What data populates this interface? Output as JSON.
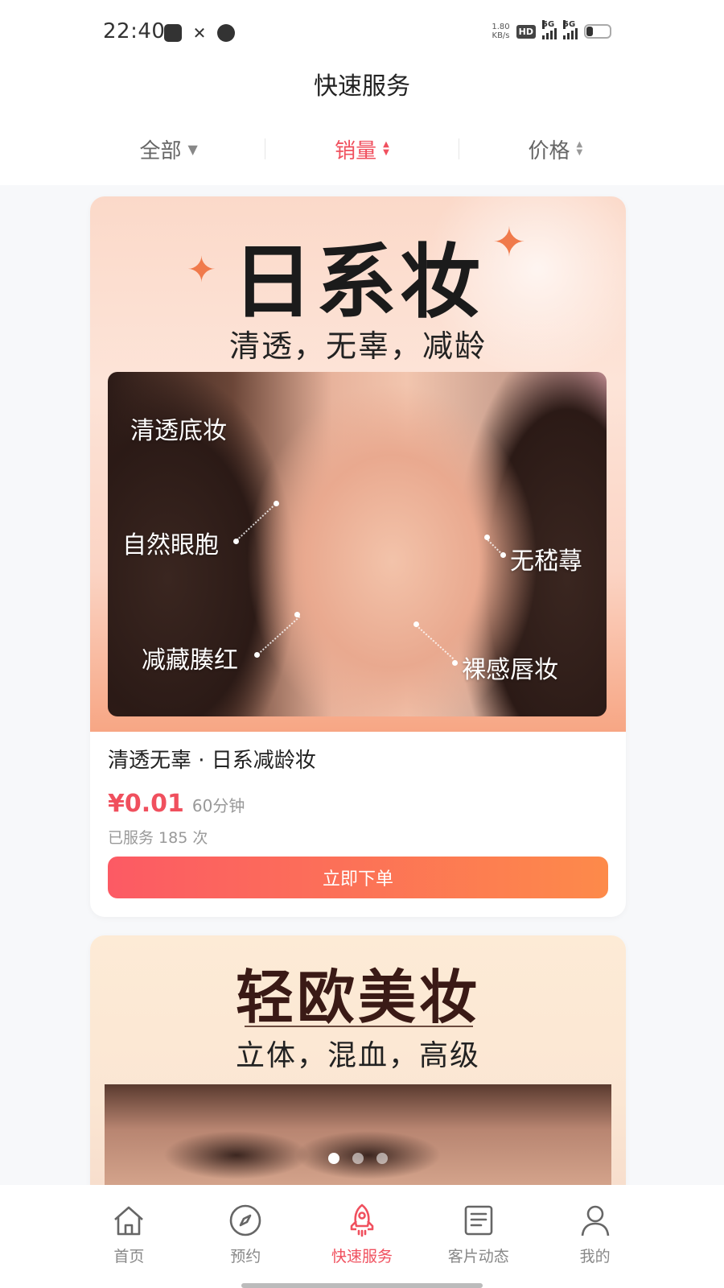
{
  "status_bar": {
    "time": "22:40",
    "net_speed_value": "1.80",
    "net_speed_unit": "KB/s",
    "hd_label": "HD",
    "signal1_label": "5G",
    "signal2_label": "5G"
  },
  "header": {
    "title": "快速服务",
    "filters": [
      {
        "label": "全部",
        "icon": "caret-down-icon"
      },
      {
        "label": "销量",
        "icon": "sort-icon",
        "active": true
      },
      {
        "label": "价格",
        "icon": "sort-icon"
      }
    ]
  },
  "services": [
    {
      "banner_title": "日系妆",
      "banner_subtitle": "清透，无辜，减龄",
      "photo_labels": [
        "清透底妆",
        "自然眼胞",
        "无嵇蕁",
        "减藏腠红",
        "裸感唇妆"
      ],
      "name": "清透无辜 · 日系减龄妆",
      "price": "¥0.01",
      "duration": "60分钟",
      "served": "已服务 185 次",
      "order_button": "立即下单"
    },
    {
      "banner_title": "轻欧美妆",
      "banner_subtitle": "立体，混血，高级"
    }
  ],
  "carousel": {
    "count": 3,
    "active_index": 0
  },
  "tab_bar": {
    "items": [
      {
        "label": "首页",
        "icon": "home-icon"
      },
      {
        "label": "预约",
        "icon": "compass-icon"
      },
      {
        "label": "快速服务",
        "icon": "rocket-icon",
        "active": true
      },
      {
        "label": "客片动态",
        "icon": "news-icon"
      },
      {
        "label": "我的",
        "icon": "user-icon"
      }
    ]
  },
  "colors": {
    "accent": "#f0505e",
    "button_gradient_start": "#fc5a64",
    "button_gradient_end": "#fd8a4a",
    "sparkle": "#f07a4b"
  }
}
